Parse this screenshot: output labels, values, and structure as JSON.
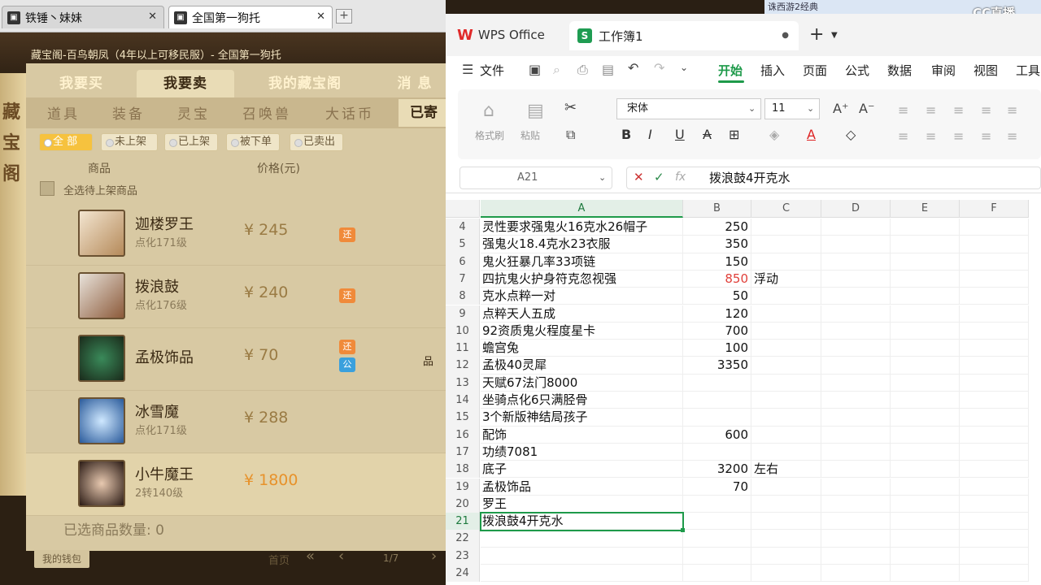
{
  "browser": {
    "tabs": [
      {
        "label": "铁锤丶妹妹",
        "close": "✕"
      },
      {
        "label": "全国第一狗托",
        "close": "✕"
      }
    ],
    "new_tab": "+"
  },
  "game": {
    "title": "藏宝阁-百鸟朝凤（4年以上可移民服）- 全国第一狗托",
    "tabs": [
      "我要买",
      "我要卖",
      "我的藏宝阁",
      "消 息"
    ],
    "categories": [
      "道具",
      "装备",
      "灵宝",
      "召唤兽",
      "大话币",
      "已寄"
    ],
    "filters": [
      "全 部",
      "未上架",
      "已上架",
      "被下单",
      "已卖出"
    ],
    "col_goods": "商品",
    "col_price": "价格(元)",
    "select_all": "全选待上架商品",
    "deco_chars": [
      "藏",
      "宝",
      "阁"
    ],
    "items": [
      {
        "name": "迦楼罗王",
        "sub": "点化171级",
        "price": "¥ 245",
        "badges": [
          "还"
        ]
      },
      {
        "name": "拨浪鼓",
        "sub": "点化176级",
        "price": "¥ 240",
        "badges": [
          "还"
        ]
      },
      {
        "name": "孟极饰品",
        "sub": "",
        "price": "¥ 70",
        "badges": [
          "还",
          "公"
        ]
      },
      {
        "name": "冰雪魔",
        "sub": "点化171级",
        "price": "¥ 288",
        "badges": []
      },
      {
        "name": "小牛魔王",
        "sub": "2转140级",
        "price": "¥ 1800",
        "badges": []
      }
    ],
    "side_label": "品",
    "selected_count": "已选商品数量: 0",
    "wallet": "我的钱包",
    "first_page": "首页",
    "page": "1/7"
  },
  "wps": {
    "brand": "WPS Office",
    "doc_tab": "工作簿1",
    "doc_dot": "●",
    "menus": [
      "文件",
      "开始",
      "插入",
      "页面",
      "公式",
      "数据",
      "审阅",
      "视图",
      "工具"
    ],
    "ribbon": {
      "format_painter": "格式刷",
      "paste": "粘贴",
      "font": "宋体",
      "size": "11"
    },
    "name_box": "A21",
    "fx": "fx",
    "formula": "拨浪鼓4开克水",
    "columns": [
      "A",
      "B",
      "C",
      "D",
      "E",
      "F"
    ],
    "rows": [
      {
        "n": "4",
        "a": "灵性要求强鬼火16克水26帽子",
        "b": "250",
        "c": ""
      },
      {
        "n": "5",
        "a": "强鬼火18.4克水23衣服",
        "b": "350",
        "c": ""
      },
      {
        "n": "6",
        "a": "鬼火狂暴几率33项链",
        "b": "150",
        "c": ""
      },
      {
        "n": "7",
        "a": "四抗鬼火护身符克忽视强",
        "b": "850",
        "c": "浮动"
      },
      {
        "n": "8",
        "a": "克水点粹一对",
        "b": "50",
        "c": ""
      },
      {
        "n": "9",
        "a": "点粹天人五成",
        "b": "120",
        "c": ""
      },
      {
        "n": "10",
        "a": "92资质鬼火程度星卡",
        "b": "700",
        "c": ""
      },
      {
        "n": "11",
        "a": "蟾宫兔",
        "b": "100",
        "c": ""
      },
      {
        "n": "12",
        "a": "孟极40灵犀",
        "b": "3350",
        "c": ""
      },
      {
        "n": "13",
        "a": "天赋67法门8000",
        "b": "",
        "c": ""
      },
      {
        "n": "14",
        "a": "坐骑点化6只满胫骨",
        "b": "",
        "c": ""
      },
      {
        "n": "15",
        "a": "3个新版神结局孩子",
        "b": "",
        "c": ""
      },
      {
        "n": "16",
        "a": "配饰",
        "b": "600",
        "c": ""
      },
      {
        "n": "17",
        "a": "功绩7081",
        "b": "",
        "c": ""
      },
      {
        "n": "18",
        "a": "底子",
        "b": "3200",
        "c": "左右"
      },
      {
        "n": "19",
        "a": "孟极饰品",
        "b": "70",
        "c": ""
      },
      {
        "n": "20",
        "a": "罗王",
        "b": "",
        "c": ""
      },
      {
        "n": "21",
        "a": "拨浪鼓4开克水",
        "b": "",
        "c": ""
      },
      {
        "n": "22",
        "a": "",
        "b": "",
        "c": ""
      },
      {
        "n": "23",
        "a": "",
        "b": "",
        "c": ""
      },
      {
        "n": "24",
        "a": "",
        "b": "",
        "c": ""
      }
    ],
    "red_row": "7",
    "active_row": "21"
  },
  "overlay": {
    "top_tab": "诛西游2经典",
    "cc_logo": "CC直播"
  },
  "colors": {
    "accent": "#1e9a4a",
    "red_value": "#e0403a",
    "price": "#e7922b"
  }
}
